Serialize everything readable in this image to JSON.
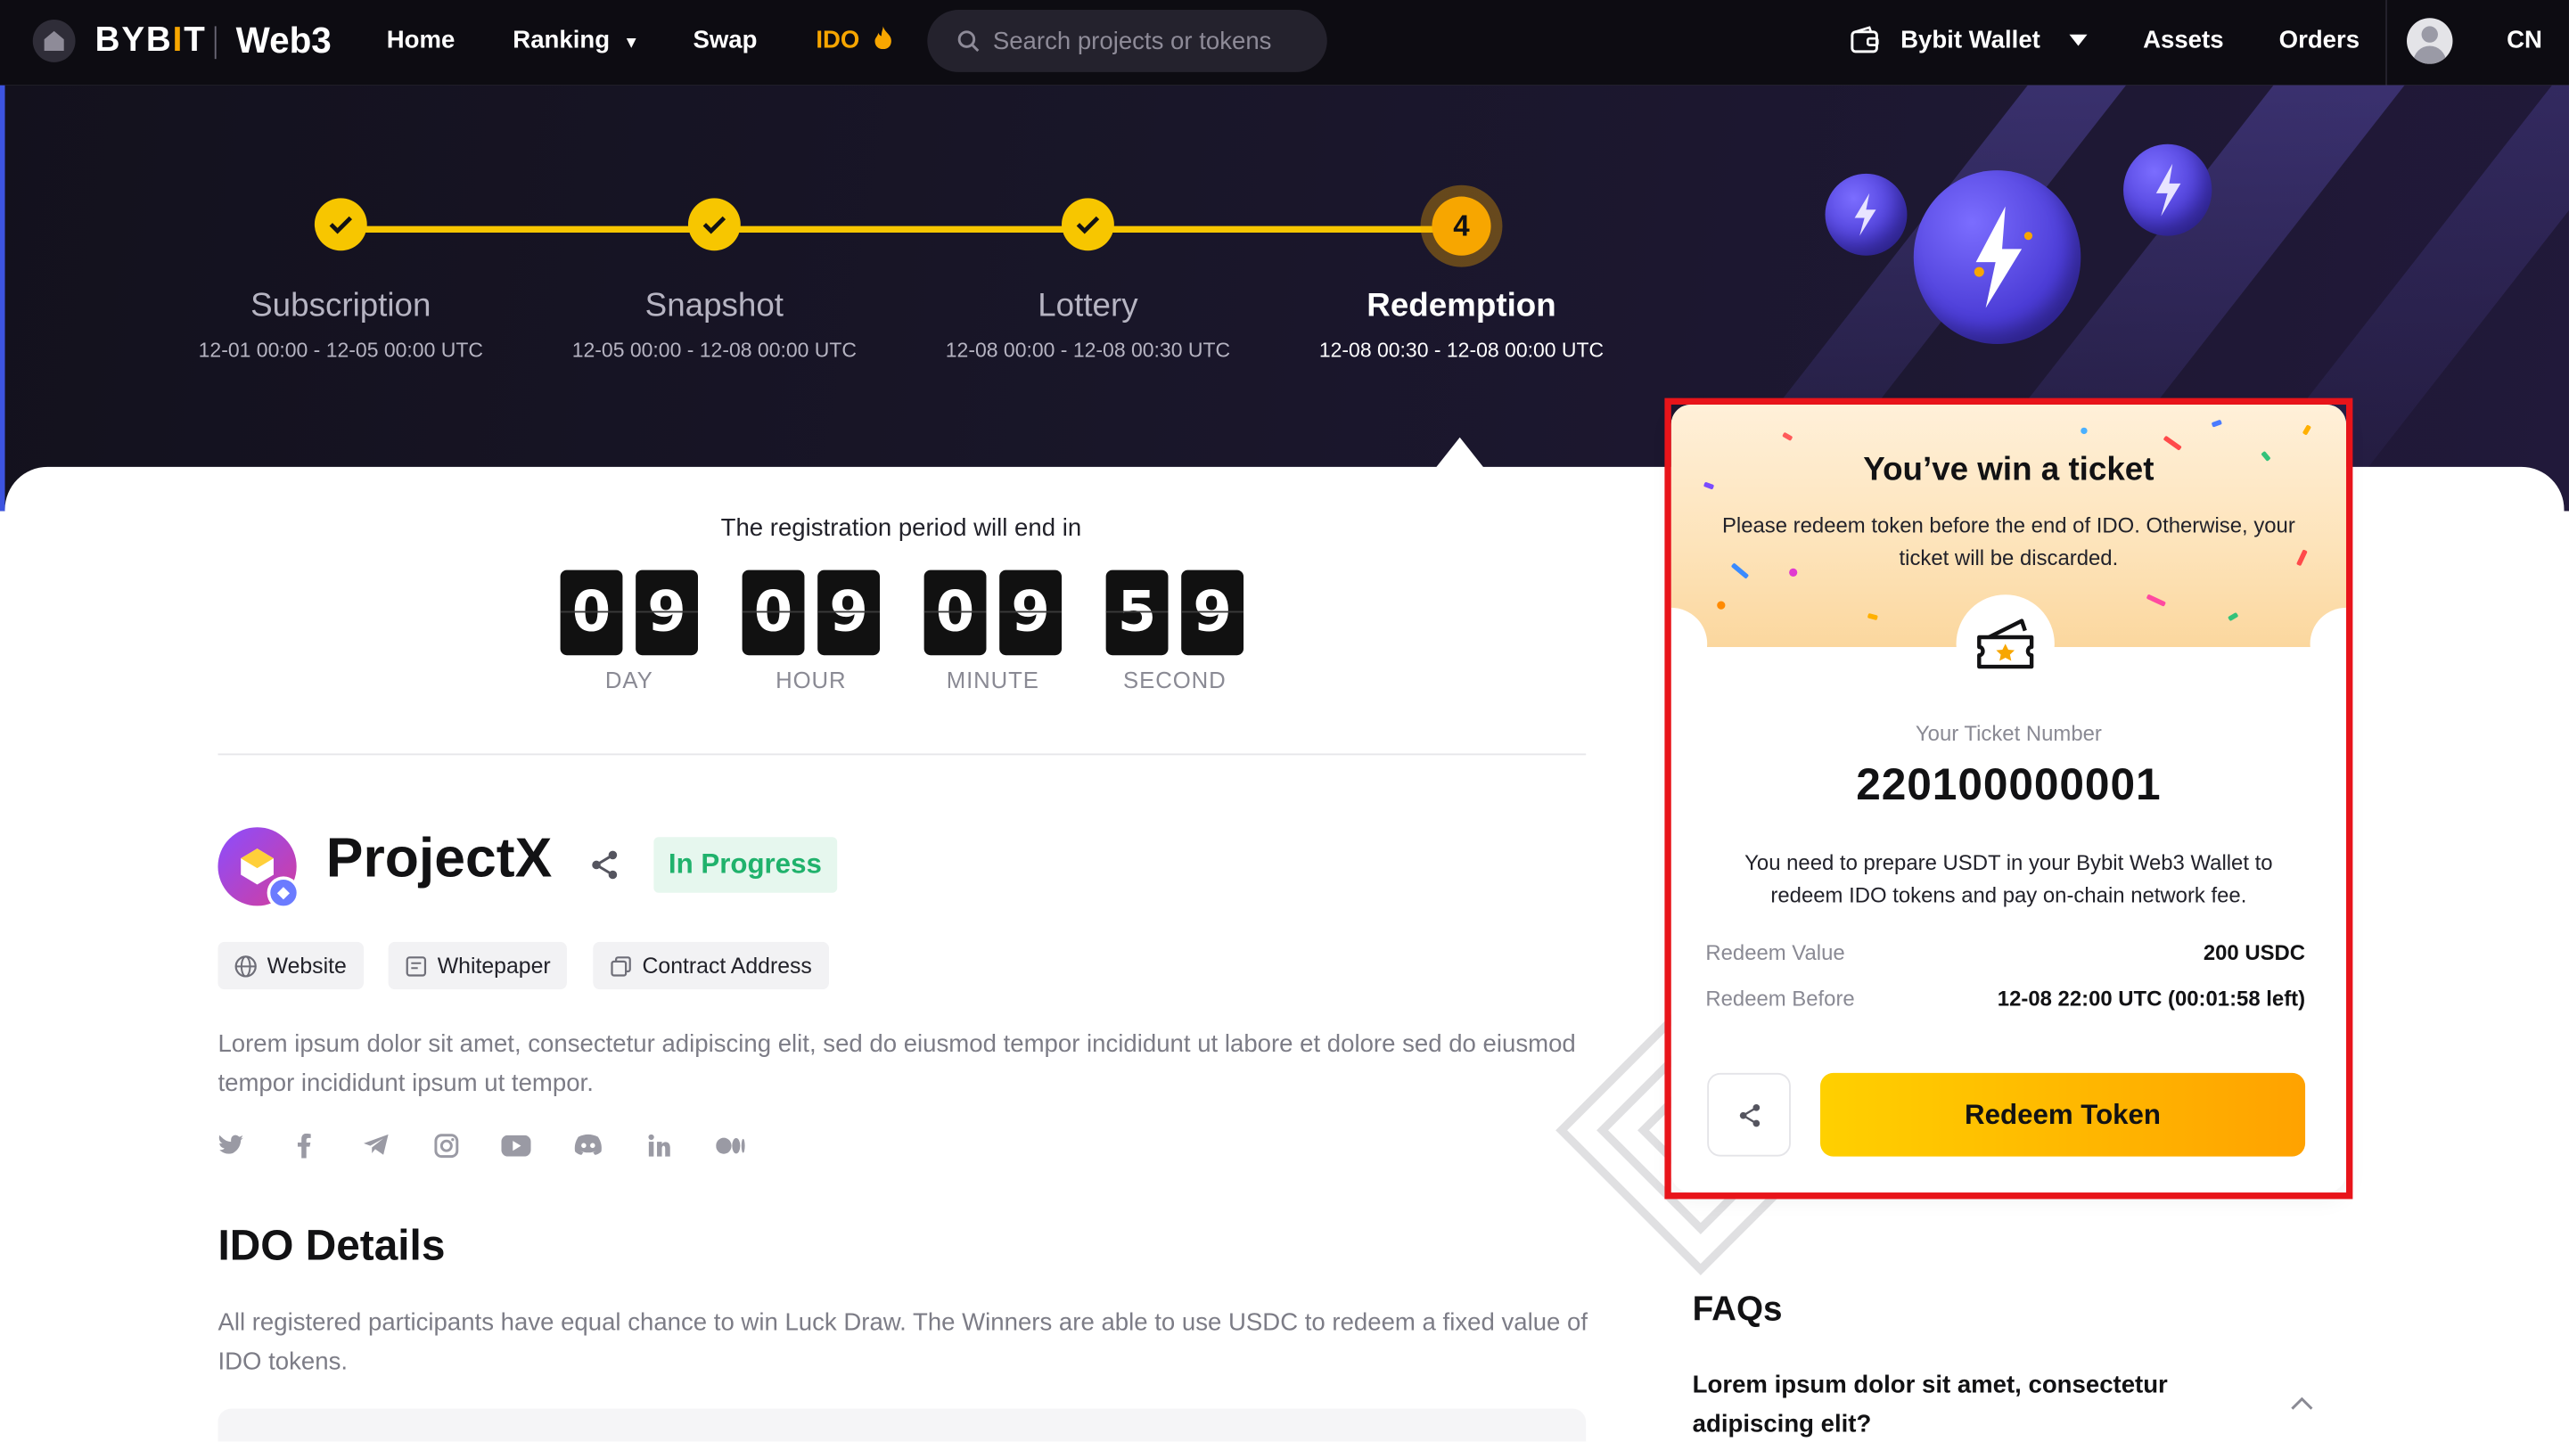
{
  "nav": {
    "logo": "BYBIT",
    "brand_suffix": "Web3",
    "links": {
      "home": "Home",
      "ranking": "Ranking",
      "swap": "Swap",
      "ido": "IDO"
    },
    "search_placeholder": "Search projects or tokens",
    "wallet_label": "Bybit Wallet",
    "assets": "Assets",
    "orders": "Orders",
    "lang": "CN"
  },
  "steps": [
    {
      "index": "1",
      "title": "Subscription",
      "date": "12-01 00:00 - 12-05 00:00 UTC",
      "state": "done"
    },
    {
      "index": "2",
      "title": "Snapshot",
      "date": "12-05 00:00 - 12-08 00:00 UTC",
      "state": "done"
    },
    {
      "index": "3",
      "title": "Lottery",
      "date": "12-08 00:00 - 12-08 00:30 UTC",
      "state": "done"
    },
    {
      "index": "4",
      "title": "Redemption",
      "date": "12-08 00:30 - 12-08 00:00 UTC",
      "state": "current"
    }
  ],
  "countdown": {
    "label": "The registration period will end in",
    "day": [
      "0",
      "9"
    ],
    "hour": [
      "0",
      "9"
    ],
    "minute": [
      "0",
      "9"
    ],
    "second": [
      "5",
      "9"
    ],
    "units": {
      "day": "DAY",
      "hour": "HOUR",
      "minute": "MINUTE",
      "second": "SECOND"
    }
  },
  "project": {
    "name": "ProjectX",
    "status": "In Progress",
    "links": {
      "website": "Website",
      "whitepaper": "Whitepaper",
      "contract": "Contract Address"
    },
    "description": "Lorem ipsum dolor sit amet, consectetur adipiscing elit, sed do eiusmod tempor incididunt ut labore et dolore sed do eiusmod tempor incididunt ipsum ut tempor.",
    "socials": [
      "twitter-icon",
      "facebook-icon",
      "telegram-icon",
      "instagram-icon",
      "youtube-icon",
      "discord-icon",
      "linkedin-icon",
      "medium-icon"
    ]
  },
  "ido_details": {
    "heading": "IDO Details",
    "description": "All registered participants have equal chance to win Luck Draw. The Winners are able to use USDC to redeem a fixed value of IDO tokens."
  },
  "ticket": {
    "title": "You’ve win a ticket",
    "subtitle": "Please redeem token before the end of IDO. Otherwise, your ticket will be discarded.",
    "number_label": "Your Ticket Number",
    "number": "220100000001",
    "note": "You need to prepare USDT in your Bybit Web3 Wallet to redeem IDO tokens and pay on-chain network fee.",
    "redeem_value_label": "Redeem Value",
    "redeem_value": "200 USDC",
    "redeem_before_label": "Redeem Before",
    "redeem_before": "12-08 22:00 UTC (00:01:58 left)",
    "button": "Redeem Token"
  },
  "faq": {
    "heading": "FAQs",
    "question": "Lorem ipsum dolor sit amet, consectetur adipiscing elit?"
  },
  "colors": {
    "accent": "#f7a600",
    "step": "#f7c600",
    "status_green": "#20b26c",
    "highlight": "#e8141a",
    "nav_bg": "#0d0c12"
  }
}
